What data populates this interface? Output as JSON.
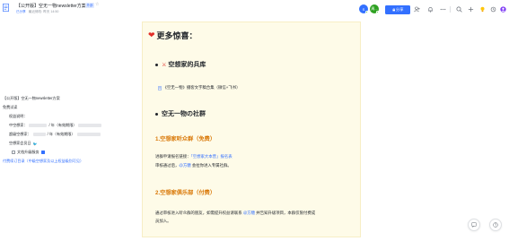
{
  "header": {
    "title": "【公开版】空无一物newsletter方案",
    "badge": "外部",
    "sub_tag": "已分享",
    "sub_text": "最近修改: 昨天 14:50",
    "avatars": [
      "S",
      "周..."
    ],
    "share_label": "分享",
    "icons": [
      "person-add-icon",
      "bell-icon",
      "more-icon",
      "search-icon",
      "plus-icon",
      "lightbulb-icon",
      "history-icon",
      "user-avatar-icon"
    ]
  },
  "outline": {
    "title": "【公开版】空无一物newsletter方案",
    "free_trial": "免费试读",
    "rights_label": "权益说明：",
    "middle_tier": "中空想家：",
    "middle_suffix": "/ 年（有效期限）",
    "super_tier": "超级空想家：",
    "super_suffix": "/ 年（有效期限）",
    "fan_group": "空想家会员日",
    "upgrade": "文档升级服务",
    "footer_link": "付费续订目录（中级空想家及以上权益级别可见）"
  },
  "block": {
    "main_heading": "更多惊喜：",
    "arsenal_heading": "空想家的兵库",
    "collection_link": "《空无一物》播客文字稿合集（微信+飞书）",
    "social_heading": "空无一物の社群",
    "fan_heading": "1.空想家听众群（免费）",
    "fan_line1_prefix": "进群申请报名链接：",
    "fan_line1_link": "「空想家大本营」报名表",
    "fan_line2_prefix": "审核通过后，",
    "fan_line2_mention": "@方糖",
    "fan_line2_suffix": " 会拉你进入专属社群。",
    "club_heading": "2.空想家俱乐部（付费）",
    "club_line1_prefix": "通过审核进入听众群的朋友，如需提升权益请联系 ",
    "club_line1_mention": "@方糖",
    "club_line1_suffix": " 并告知升级项目，本群仅限付费成",
    "club_line2": "员加入。"
  },
  "colors": {
    "accent": "#3370ff",
    "block_bg": "#fefbe8",
    "heading_orange": "#d97706"
  }
}
